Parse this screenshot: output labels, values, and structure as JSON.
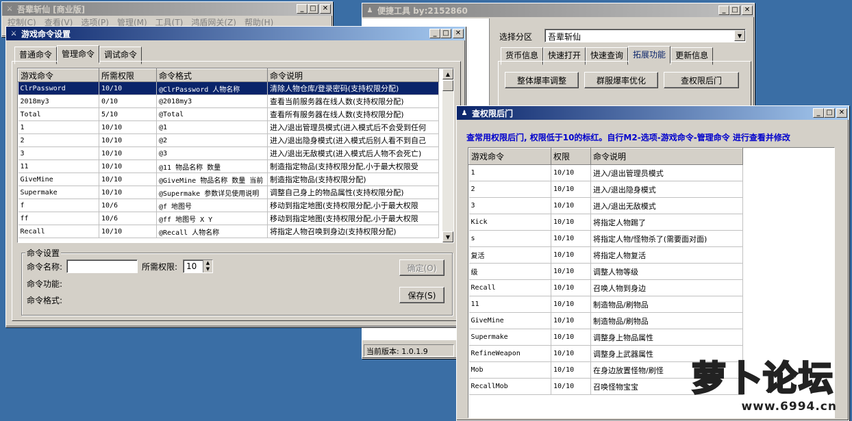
{
  "main_window": {
    "title": "吾辈斩仙 [商业版]",
    "menu": [
      "控制(C)",
      "查看(V)",
      "选项(P)",
      "管理(M)",
      "工具(T)",
      "鸿盾网关(Z)",
      "帮助(H)"
    ]
  },
  "settings_window": {
    "title": "游戏命令设置",
    "tabs": [
      "普通命令",
      "管理命令",
      "调试命令"
    ],
    "columns": [
      "游戏命令",
      "所需权限",
      "命令格式",
      "命令说明"
    ],
    "rows": [
      [
        "ClrPassword",
        "10/10",
        "@ClrPassword 人物名称",
        "清除人物仓库/登录密码(支持权限分配)"
      ],
      [
        "2018my3",
        "0/10",
        "@2018my3",
        "查看当前服务器在线人数(支持权限分配)"
      ],
      [
        "Total",
        "5/10",
        "@Total",
        "查看所有服务器在线人数(支持权限分配)"
      ],
      [
        "1",
        "10/10",
        "@1",
        "进入/退出管理员模式(进入模式后不会受到任何"
      ],
      [
        "2",
        "10/10",
        "@2",
        "进入/退出隐身模式(进入模式后别人看不到自己"
      ],
      [
        "3",
        "10/10",
        "@3",
        "进入/退出无敌模式(进入模式后人物不会死亡)"
      ],
      [
        "11",
        "10/10",
        "@11 物品名称 数量",
        "制造指定物品(支持权限分配,小于最大权限受"
      ],
      [
        "GiveMine",
        "10/10",
        "@GiveMine 物品名称 数量 当前",
        "制造指定物品(支持权限分配)"
      ],
      [
        "Supermake",
        "10/10",
        "@Supermake 参数详见使用说明",
        "调整自己身上的物品属性(支持权限分配)"
      ],
      [
        "f",
        "10/6",
        "@f 地图号",
        "移动到指定地图(支持权限分配,小于最大权限"
      ],
      [
        "ff",
        "10/6",
        "@ff 地图号 X Y",
        "移动到指定地图(支持权限分配,小于最大权限"
      ],
      [
        "Recall",
        "10/10",
        "@Recall 人物名称",
        "将指定人物召唤到身边(支持权限分配)"
      ]
    ],
    "group_title": "命令设置",
    "name_label": "命令名称:",
    "name_value": "",
    "perm_label": "所需权限:",
    "perm_value": "10",
    "func_label": "命令功能:",
    "format_label": "命令格式:",
    "confirm_label": "确定(O)",
    "save_label": "保存(S)"
  },
  "tools_window": {
    "title": "便捷工具   by:2152860",
    "zone_label": "选择分区",
    "zone_value": "吾辈斩仙",
    "tabs": [
      "货币信息",
      "快速打开",
      "快速查询",
      "拓展功能",
      "更新信息"
    ],
    "buttons": [
      "整体爆率调整",
      "群服爆率优化",
      "查权限后门"
    ],
    "version": "当前版本: 1.0.1.9"
  },
  "backdoor_window": {
    "title": "查权限后门",
    "notice": "查常用权限后门, 权限低于10的标红。自行M2-选项-游戏命令-管理命令 进行查看并修改",
    "columns": [
      "游戏命令",
      "权限",
      "命令说明"
    ],
    "rows": [
      [
        "1",
        "10/10",
        "进入/退出管理员模式"
      ],
      [
        "2",
        "10/10",
        "进入/退出隐身模式"
      ],
      [
        "3",
        "10/10",
        "进入/退出无敌模式"
      ],
      [
        "Kick",
        "10/10",
        "将指定人物踢了"
      ],
      [
        "s",
        "10/10",
        "将指定人物/怪物杀了(需要面对面)"
      ],
      [
        "复活",
        "10/10",
        "将指定人物复活"
      ],
      [
        "级",
        "10/10",
        "调整人物等级"
      ],
      [
        "Recall",
        "10/10",
        "召唤人物到身边"
      ],
      [
        "11",
        "10/10",
        "制造物品/刷物品"
      ],
      [
        "GiveMine",
        "10/10",
        "制造物品/刷物品"
      ],
      [
        "Supermake",
        "10/10",
        "调整身上物品属性"
      ],
      [
        "RefineWeapon",
        "10/10",
        "调整身上武器属性"
      ],
      [
        "Mob",
        "10/10",
        "在身边放置怪物/刷怪"
      ],
      [
        "RecallMob",
        "10/10",
        "召唤怪物宝宝"
      ]
    ]
  },
  "watermark": {
    "brand": "萝卜论坛",
    "url": "www.6994.cn"
  },
  "colors": {
    "desktop": "#3a6ea5",
    "title_active": "#0a246a",
    "notice_text": "#0000cc",
    "logo_orange": "#f5a623"
  }
}
